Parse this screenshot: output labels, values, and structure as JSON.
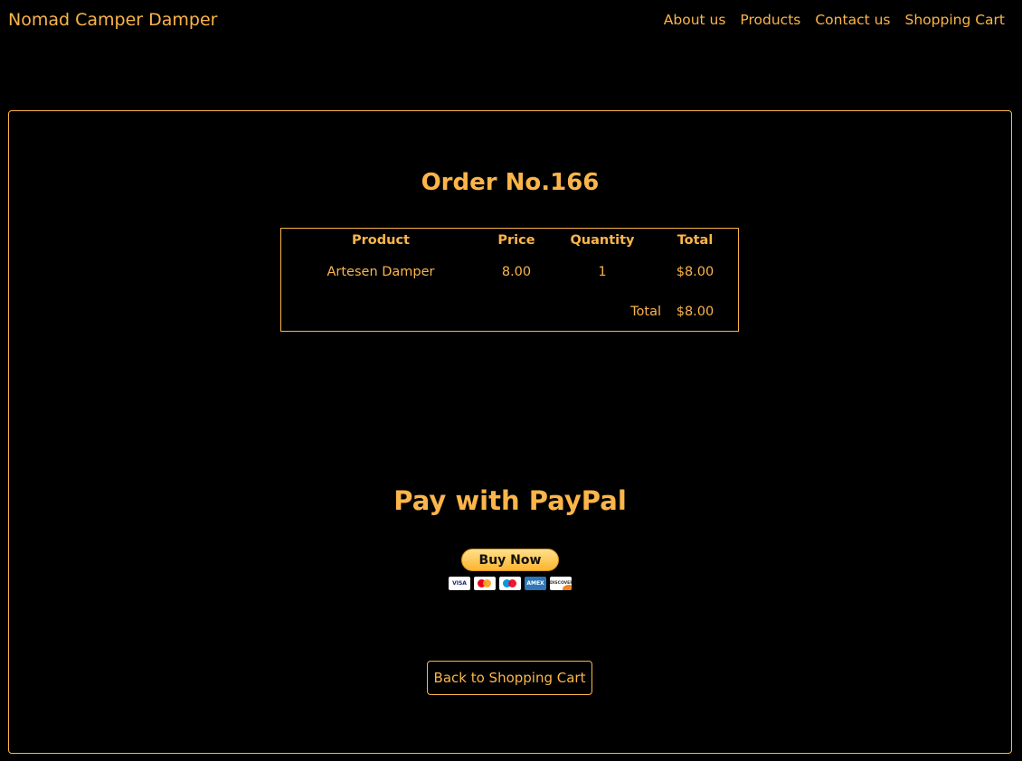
{
  "nav": {
    "brand": "Nomad Camper Damper",
    "links": [
      "About us",
      "Products",
      "Contact us",
      "Shopping Cart"
    ]
  },
  "order": {
    "title": "Order No.166",
    "columns": [
      "Product",
      "Price",
      "Quantity",
      "Total"
    ],
    "rows": [
      {
        "product": "Artesen Damper",
        "price": "8.00",
        "quantity": "1",
        "total": "$8.00"
      }
    ],
    "total_label": "Total",
    "total_value": "$8.00"
  },
  "paypal": {
    "title": "Pay with PayPal",
    "button_label": "Buy Now",
    "cards": [
      "VISA",
      "mastercard",
      "maestro",
      "AMEX",
      "DISCOVER"
    ]
  },
  "back_button": "Back to Shopping Cart",
  "colors": {
    "accent": "#fcb54a",
    "background": "#000000"
  }
}
